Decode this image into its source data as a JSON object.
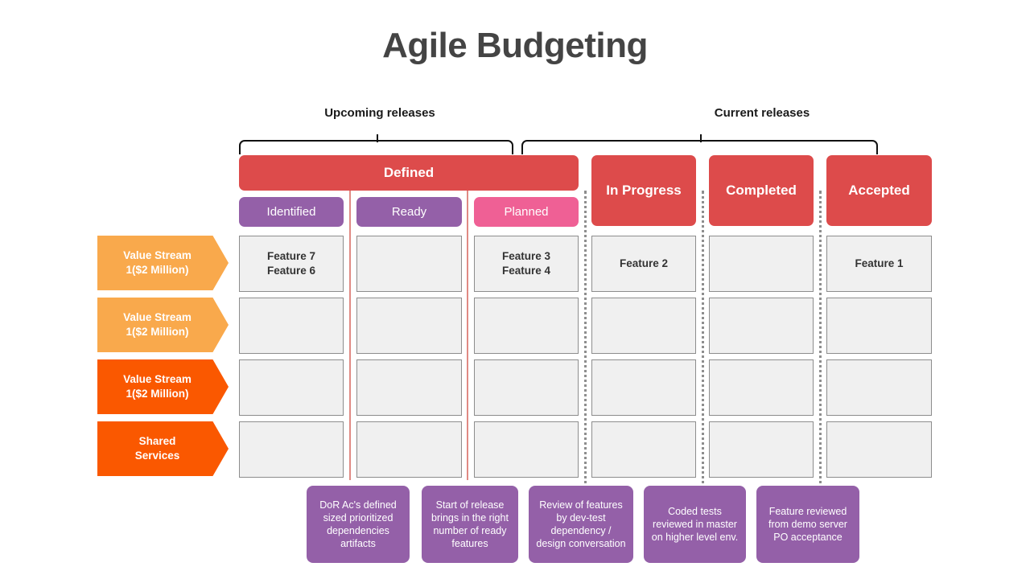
{
  "title": "Agile Budgeting",
  "groups": [
    {
      "label": "Upcoming releases"
    },
    {
      "label": "Current releases"
    }
  ],
  "columns": {
    "defined": "Defined",
    "in_progress": "In Progress",
    "completed": "Completed",
    "accepted": "Accepted"
  },
  "subcolumns": [
    {
      "label": "Identified",
      "color": "#9460a8"
    },
    {
      "label": "Ready",
      "color": "#9460a8"
    },
    {
      "label": "Planned",
      "color": "#ef6095"
    }
  ],
  "rows": [
    {
      "label": "Value Stream\n1($2 Million)",
      "color": "#f9a94c"
    },
    {
      "label": "Value Stream\n1($2 Million)",
      "color": "#f9a94c"
    },
    {
      "label": "Value Stream\n1($2 Million)",
      "color": "#fa5800"
    },
    {
      "label": "Shared\nServices",
      "color": "#fa5800"
    }
  ],
  "cells": [
    [
      "Feature 7\nFeature 6",
      "",
      "Feature 3\nFeature 4",
      "Feature 2",
      "",
      "Feature 1"
    ],
    [
      "",
      "",
      "",
      "",
      "",
      ""
    ],
    [
      "",
      "",
      "",
      "",
      "",
      ""
    ],
    [
      "",
      "",
      "",
      "",
      "",
      ""
    ]
  ],
  "notes": [
    "DoR Ac's defined sized prioritized dependencies artifacts",
    "Start of release brings in the right number of ready features",
    "Review of features by dev-test dependency / design conversation",
    "Coded tests reviewed in master on higher level env.",
    "Feature reviewed from demo server PO acceptance"
  ],
  "colors": {
    "header_red": "#dd4b4b",
    "cell_fill": "#f0f0f0",
    "note_purple": "#9460a8",
    "title_gray": "#444444"
  }
}
